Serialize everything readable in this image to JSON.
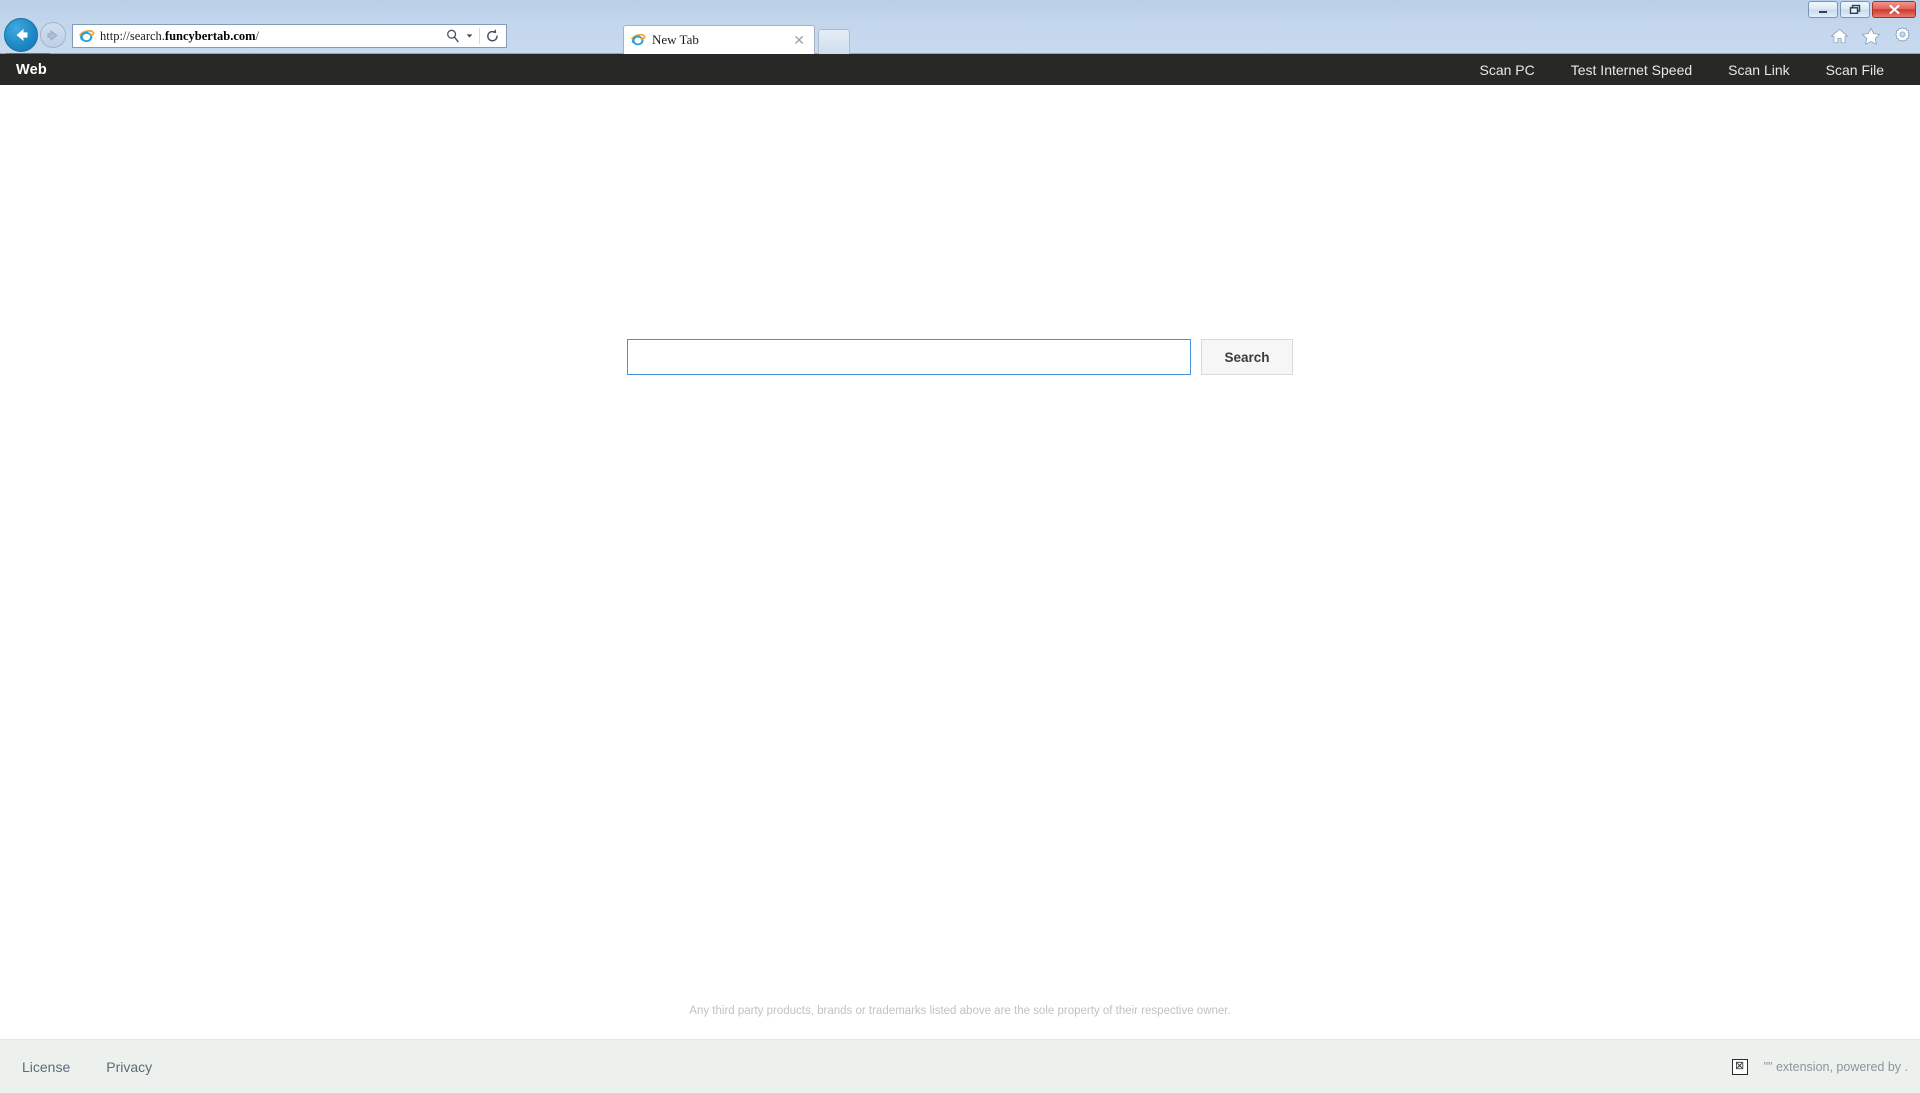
{
  "browser": {
    "window_controls": {
      "minimize_label": "Minimize",
      "restore_label": "Restore",
      "close_label": "Close"
    },
    "back_button_label": "Back",
    "forward_button_label": "Forward",
    "address": {
      "url_prefix": "http://search.",
      "url_domain": "funcybertab.com",
      "url_suffix": "/",
      "full_url": "http://search.funcybertab.com/",
      "search_icon": "magnifier-icon",
      "dropdown_icon": "chevron-down-icon",
      "refresh_icon": "refresh-icon"
    },
    "tab": {
      "title": "New Tab",
      "favicon": "internet-explorer-icon",
      "close_icon": "close-icon"
    },
    "new_tab_button_label": "New tab",
    "toolbar_icons": [
      {
        "name": "home-icon",
        "label": "Home"
      },
      {
        "name": "favorites-star-icon",
        "label": "Favorites"
      },
      {
        "name": "settings-gear-icon",
        "label": "Tools"
      }
    ]
  },
  "extension_nav": {
    "brand": "Web",
    "links": [
      {
        "label": "Scan PC"
      },
      {
        "label": "Test Internet Speed"
      },
      {
        "label": "Scan Link"
      },
      {
        "label": "Scan File"
      }
    ],
    "background_color": "#282826",
    "text_color": "#e8e8e6"
  },
  "search": {
    "value": "",
    "placeholder": "",
    "button_label": "Search",
    "focus_border_color": "#4a90e2"
  },
  "disclaimer": "Any third party products, brands or trademarks listed above are the sole property of their respective owner.",
  "footer": {
    "links": [
      {
        "label": "License"
      },
      {
        "label": "Privacy"
      }
    ],
    "broken_image_icon": "broken-image-icon",
    "broken_image_glyph": "⊠",
    "powered_by_text": "\"\" extension, powered by .",
    "background_color": "#edf1ee"
  }
}
